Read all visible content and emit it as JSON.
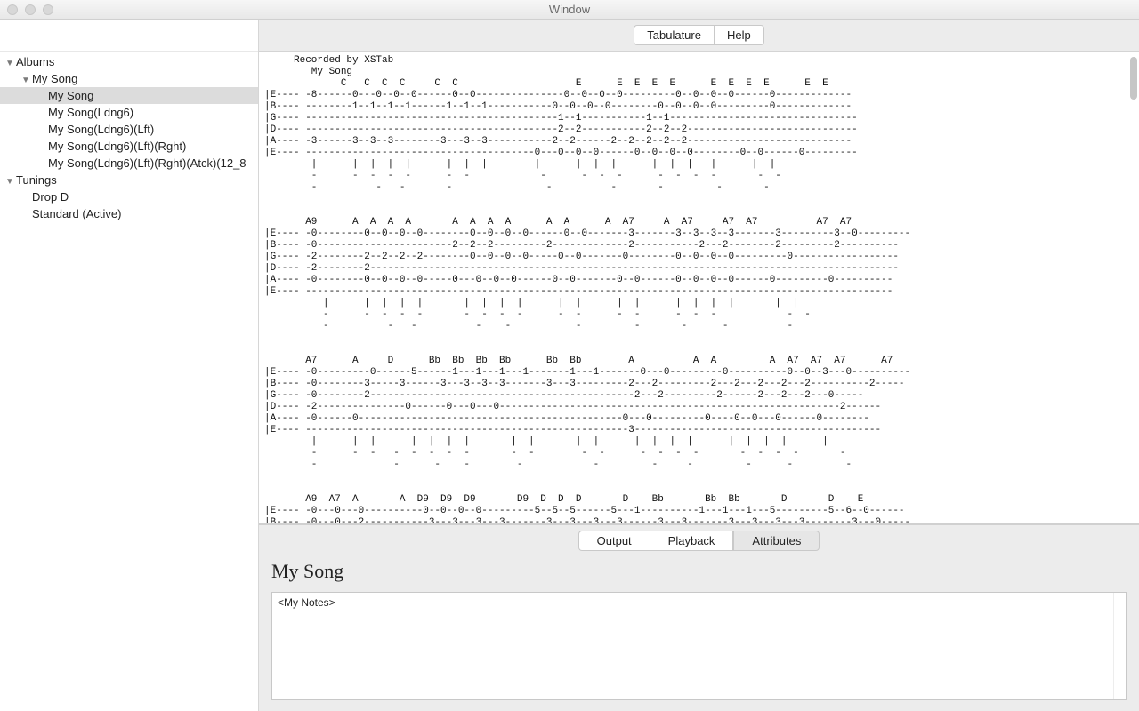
{
  "window": {
    "title": "Window"
  },
  "top_tabs": {
    "tab0": "Tabulature",
    "tab1": "Help",
    "active": 0
  },
  "sidebar": {
    "nodes": [
      {
        "label": "Albums",
        "indent": 0,
        "disclosure": "▼"
      },
      {
        "label": "My Song",
        "indent": 1,
        "disclosure": "▼"
      },
      {
        "label": "My Song",
        "indent": 2,
        "selected": true
      },
      {
        "label": "My Song(Ldng6)",
        "indent": 2
      },
      {
        "label": "My Song(Ldng6)(Lft)",
        "indent": 2
      },
      {
        "label": "My Song(Ldng6)(Lft)(Rght)",
        "indent": 2
      },
      {
        "label": "My Song(Ldng6)(Lft)(Rght)(Atck)(12_8",
        "indent": 2
      },
      {
        "label": "Tunings",
        "indent": 0,
        "disclosure": "▼"
      },
      {
        "label": "Drop D",
        "indent": 1
      },
      {
        "label": "Standard (Active)",
        "indent": 1
      }
    ]
  },
  "tab_text": "     Recorded by XSTab\n        My Song\n             C   C  C  C     C  C                    E      E  E  E  E      E  E  E  E      E  E\n|E---- -8------0---0--0--0------0--0---------------0--0--0--0---------0--0--0--0------0-------------\n|B---- --------1--1--1--1------1--1--1-----------0--0--0--0--------0--0--0--0---------0-------------\n|G---- -------------------------------------------1--1-----------1--1--------------------------------\n|D---- -------------------------------------------2--2-----------2--2--2-----------------------------\n|A---- -3------3--3--3--------3---3--3-----------2--2------2--2--2--2--2----------------------------\n|E---- ---------------------------------------0---0--0--0------0--0--0--0--------0--0------0---------\n        |      |  |  |  |      |  |  |        |      |  |  |      |  |  |   |      |  |\n        -      -  -  -  -      -  -            -      -  -  -      -  -  -  -       -  -\n        -          -   -       -                -          -       -         -       -\n\n\n       A9      A  A  A  A       A  A  A  A      A  A      A  A7     A  A7     A7  A7          A7  A7\n|E---- -0--------0--0--0--0--------0--0--0--0------0--0-------3-------3--3--3--3-------3---------3--0---------\n|B---- -0-----------------------2--2--2---------2-------------2-----------2---2--------2---------2----------\n|G---- -2--------2--2--2--2--------0--0--0--0-----0--0-------0--------0--0--0--0---------0------------------\n|D---- -2--------2------------------------------------------------------------------------------------------\n|A---- -0--------0--0--0--0-----0---0--0--0------0--0-------0--0------0--0--0--0------0---------0----------\n|E---- ----------------------------------------------------------------------------------------------------\n          |      |  |  |  |       |  |  |  |      |  |      |  |      |  |  |  |       |  |\n          -      -  -  -  -       -  -  -  -      -  -      -  -      -  -  -            -  -\n          -          -   -          -    -           -         -       -      -          -\n\n\n       A7      A     D      Bb  Bb  Bb  Bb      Bb  Bb        A          A  A         A  A7  A7  A7      A7\n|E---- -0---------0------5------1---1---1---1-------1---1-------0---0---------0----------0--0--3---0----------\n|B---- -0--------3-----3------3---3--3--3-------3---3---------2---2---------2---2---2---2---2----------2-----\n|G---- -0--------2---------------------------------------------2---2---------2------2---2---2---0-----\n|D---- -2---------------0------0---0---0----------------------------------------------------------2------\n|A---- -0------0---------------------------------------------0---0---------0----0--0---0------0--------\n|E---- -------------------------------------------------------3------------------------------------------\n        |      |  |      |  |  |  |       |  |       |  |      |  |  |  |      |  |  |  |      |\n        -      -  -   -  -  -  -  -       -  -        -  -      -  -  -  -       -  -  -  -       -\n        -             -      -    -        -            -         -     -         -      -         -\n\n\n       A9  A7  A       A  D9  D9  D9       D9  D  D  D       D    Bb       Bb  Bb       D       D    E\n|E---- -0---0---0----------0--0--0--0---------5--5--5------5---1----------1---1---1---5---------5--6--0------\n|B---- -0---0---2-----------3---3---3---3-------3---3---3---3------3---3-------3---3---3---3--------3---0-----\n|G---- -2---0---0-----------2--2--2--2-------2---2---2---2---------------------------------------1--------\n|D---- -2---2---2-----------0--0--0--0-------0---0---0---0------0---0---0------0---0------0-------0---------2----\n|A---- -0---0---0---------------------------------------------------------------------------------------2-----\n|E---- -0---------------------------------------------------------------------------------------0------",
  "bottom": {
    "tabs": {
      "t0": "Output",
      "t1": "Playback",
      "t2": "Attributes",
      "active": 2
    },
    "title": "My Song",
    "notes": "<My Notes>"
  }
}
